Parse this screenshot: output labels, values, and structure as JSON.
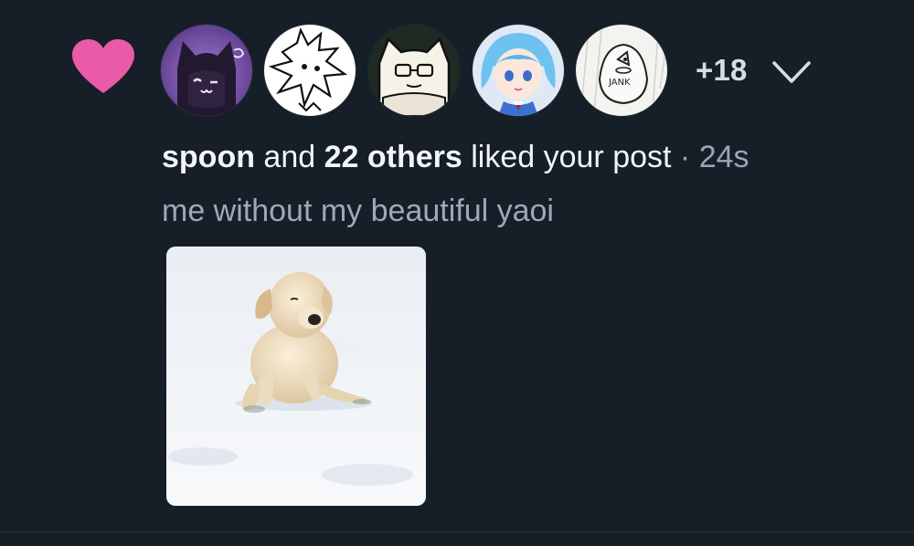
{
  "notification": {
    "type_icon": "heart-icon",
    "heart_color": "#ea5aa8",
    "avatars": [
      {
        "icon": "avatar-dark-cat-icon",
        "accent": "#6f4ba5"
      },
      {
        "icon": "avatar-sketch-character-icon",
        "accent": "#ffffff"
      },
      {
        "icon": "avatar-glasses-cat-icon",
        "accent": "#ffffff"
      },
      {
        "icon": "avatar-blue-hair-anime-icon",
        "accent": "#6ec2ef"
      },
      {
        "icon": "avatar-jank-sketch-icon",
        "accent": "#ffffff"
      }
    ],
    "more_count": "+18",
    "expand_icon": "chevron-down-icon",
    "actor_name": "spoon",
    "and_text": " and ",
    "others_text": "22 others",
    "action_text": " liked your post",
    "separator": " · ",
    "timestamp": "24s",
    "post_text": "me without my beautiful yaoi",
    "thumbnail_icon": "puppy-in-snow-image-icon"
  },
  "colors": {
    "background": "#161e27",
    "primary_text": "#f2f4f7",
    "muted_text": "#9ea9b6",
    "heart": "#ea5aa8"
  }
}
